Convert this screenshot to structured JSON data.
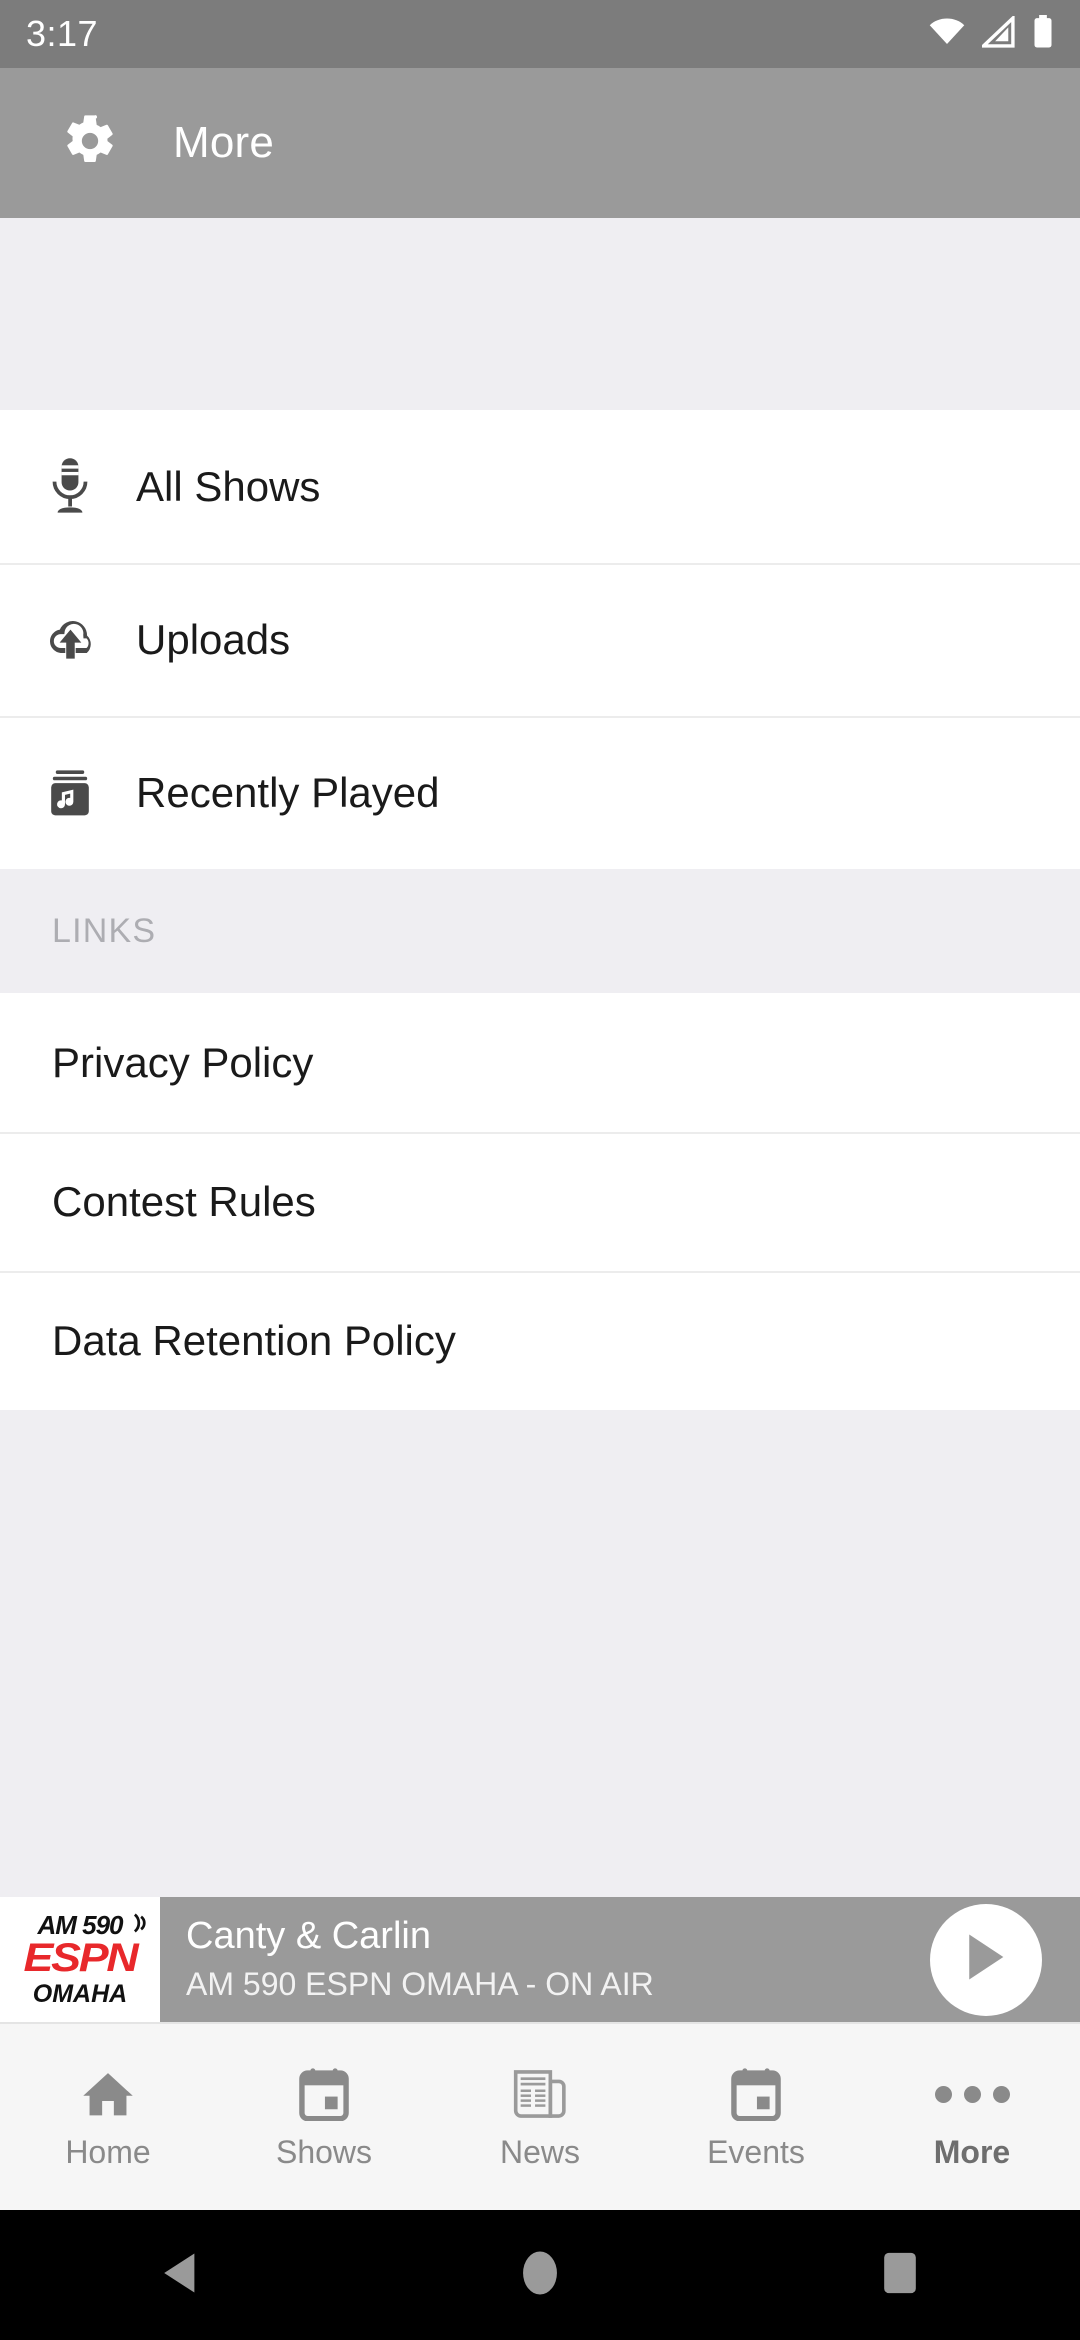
{
  "status_bar": {
    "time": "3:17",
    "icons": [
      "wifi-icon",
      "cellular-signal-icon",
      "battery-icon"
    ],
    "background": "#7C7C7C"
  },
  "app_bar": {
    "icon": "gear-icon",
    "title": "More",
    "background": "#9A9A9A"
  },
  "menu": {
    "items": [
      {
        "icon": "microphone-icon",
        "label": "All Shows"
      },
      {
        "icon": "cloud-upload-icon",
        "label": "Uploads"
      },
      {
        "icon": "music-library-icon",
        "label": "Recently Played"
      }
    ]
  },
  "links_section": {
    "header": "LINKS",
    "items": [
      {
        "label": "Privacy Policy"
      },
      {
        "label": "Contest Rules"
      },
      {
        "label": "Data Retention Policy"
      }
    ]
  },
  "now_playing": {
    "station_logo": {
      "line1": "AM 590",
      "line2": "ESPN",
      "line3": "OMAHA",
      "wave_glyph": "))",
      "accent_color": "#E8282B"
    },
    "title": "Canty & Carlin",
    "subtitle": "AM 590 ESPN OMAHA - ON AIR",
    "play_button": "play-icon",
    "background": "#9A9A9A"
  },
  "tab_bar": {
    "tabs": [
      {
        "icon": "home-icon",
        "label": "Home",
        "active": false
      },
      {
        "icon": "calendar-icon",
        "label": "Shows",
        "active": false
      },
      {
        "icon": "newspaper-icon",
        "label": "News",
        "active": false
      },
      {
        "icon": "calendar-icon",
        "label": "Events",
        "active": false
      },
      {
        "icon": "more-dots-icon",
        "label": "More",
        "active": true
      }
    ]
  },
  "system_nav": {
    "back": "back-triangle-icon",
    "home": "home-circle-icon",
    "recents": "recents-square-icon"
  }
}
